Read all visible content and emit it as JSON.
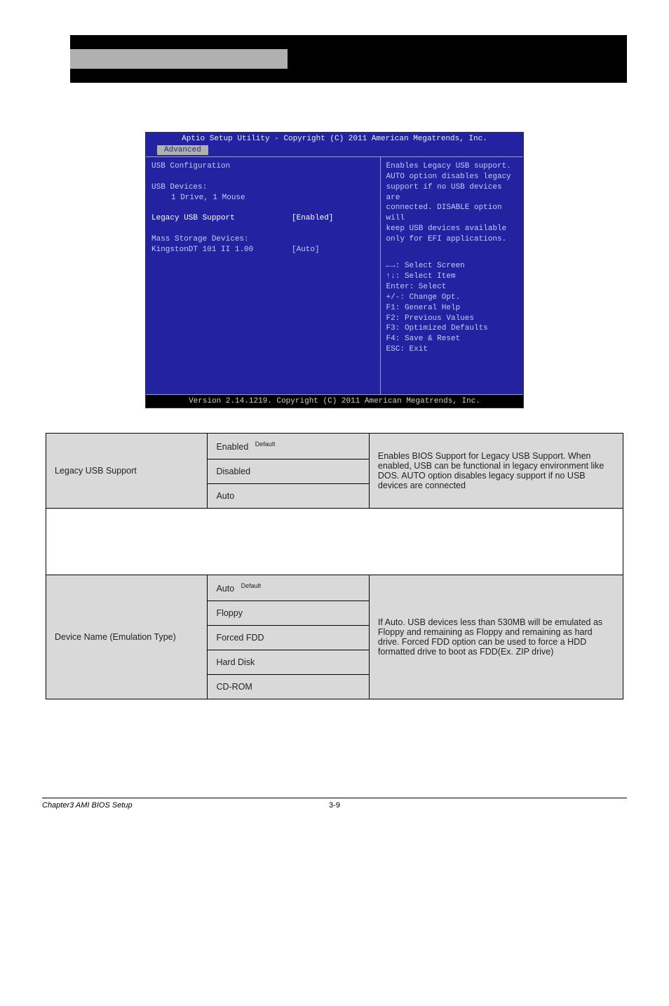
{
  "header": {},
  "bios": {
    "title": "Aptio Setup Utility - Copyright (C) 2011 American Megatrends, Inc.",
    "tab": "Advanced",
    "left": {
      "heading": "USB Configuration",
      "devices_heading": "USB Devices:",
      "devices_value": "1 Drive, 1 Mouse",
      "legacy_label": "Legacy USB Support",
      "legacy_value": "[Enabled]",
      "mass_heading": "Mass Storage Devices:",
      "mass_device_label": "KingstonDT 101 II 1.00",
      "mass_device_value": "[Auto]"
    },
    "right": {
      "help_l1": "Enables Legacy USB support.",
      "help_l2": "AUTO option disables legacy",
      "help_l3": "support if no USB devices are",
      "help_l4": "connected. DISABLE option will",
      "help_l5": "keep USB devices available",
      "help_l6": "only for EFI applications.",
      "nav_l1": "←→: Select Screen",
      "nav_l2": "↑↓: Select Item",
      "nav_l3": "Enter: Select",
      "nav_l4": "+/-: Change Opt.",
      "nav_l5": "F1: General Help",
      "nav_l6": "F2: Previous Values",
      "nav_l7": "F3: Optimized Defaults",
      "nav_l8": "F4: Save & Reset",
      "nav_l9": "ESC: Exit"
    },
    "footer": "Version 2.14.1219. Copyright (C) 2011 American Megatrends, Inc."
  },
  "table": {
    "row1": {
      "name": "Legacy USB Support",
      "opts": [
        "Enabled",
        "Disabled",
        "Auto"
      ],
      "default_idx": 0,
      "desc": "Enables BIOS Support for Legacy USB Support. When enabled, USB can be functional in legacy environment like DOS. AUTO option disables legacy support if no USB devices are connected"
    },
    "row2": {
      "name": "Device Name (Emulation Type)",
      "opts": [
        "Auto",
        "Floppy",
        "Forced FDD",
        "Hard Disk",
        "CD-ROM"
      ],
      "default_idx": 0,
      "desc": "If Auto. USB devices less than 530MB will be emulated as Floppy and remaining as Floppy and remaining as hard drive. Forced FDD option can be used to force a HDD formatted drive to boot as FDD(Ex. ZIP drive)"
    },
    "default_label": "Default"
  },
  "footer": {
    "left": "Chapter3 AMI BIOS Setup",
    "center": "3-9",
    "right": ""
  }
}
